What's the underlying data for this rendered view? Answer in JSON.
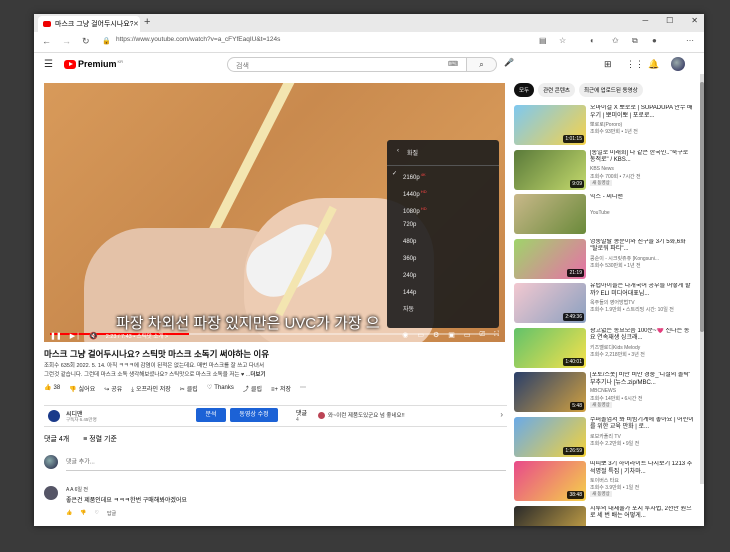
{
  "browser": {
    "tab_title": "마스크 그냥 걸어두시나요? 스틱",
    "tab_close": "✕",
    "new_tab": "+",
    "url": "https://www.youtube.com/watch?v=a_cFYfEaqIU&t=124s"
  },
  "header": {
    "logo": "Premium",
    "logo_region": "KR",
    "search_placeholder": "검색"
  },
  "player": {
    "subtitle": "파장 차외선 파장 있지만은 UVC가 가장 으",
    "time": "2:23 / 7:43 • 스틱맛 소개 >",
    "progress": 0.31,
    "quality_menu": {
      "header": "화질",
      "options": [
        "2160p",
        "1440p",
        "1080p",
        "720p",
        "480p",
        "360p",
        "240p",
        "144p",
        "자동"
      ],
      "hd_badges": [
        "4K",
        "HD",
        "HD",
        "",
        "",
        "",
        "",
        "",
        ""
      ],
      "selected": "2160p"
    }
  },
  "video": {
    "title": "마스크 그냥 걸어두시나요? 스틱맛 마스크 소독기 써야하는 이유",
    "meta_line1": "조회수 635회 2022. 5. 14. 아직 ㅋㅋㅋ에 감염이 된적은 없는데요. 매번 마스크를 잘 쓰고 다녀서",
    "meta_line2": "그런것 같습니다. 그런데 마스크 소독 생각해보셨나요? 스틱맛으로 마스크 소독을 저는 ♥ ...",
    "more": "더보기",
    "actions": [
      {
        "icon": "👍",
        "label": "38"
      },
      {
        "icon": "👎",
        "label": "싫어요"
      },
      {
        "icon": "↪",
        "label": "공유"
      },
      {
        "icon": "⤓",
        "label": "오프라인 저장"
      },
      {
        "icon": "✂",
        "label": "클립"
      },
      {
        "icon": "♡",
        "label": "Thanks"
      },
      {
        "icon": "⤴",
        "label": "클립"
      },
      {
        "icon": "≡+",
        "label": "저장"
      },
      {
        "icon": "⋯",
        "label": ""
      }
    ]
  },
  "channel": {
    "name": "씨디맨",
    "subs": "구독자 6.45만명",
    "analytics_btn": "분석",
    "edit_btn": "동영상 수정",
    "comments_label": "댓글",
    "comments_num": "4",
    "comment_preview": "와~이런 제품도있군요 넘 좋네요!!"
  },
  "comments": {
    "count_label": "댓글 4개",
    "sort_label": "정렬 기준",
    "add_placeholder": "댓글 추가...",
    "first": {
      "user": "A A",
      "time": "6일 전",
      "text": "좋은건 제품인데요 ㅋㅋㅋ한번 구매해봐야겠어요",
      "reply": "답글"
    }
  },
  "sidebar": {
    "chips": [
      "모두",
      "관련 콘텐츠",
      "최근에 업로드된 동영상"
    ],
    "items": [
      {
        "title": "오마이걸 X 뽀로로 | SUPADUPA 안무 배우기 | 뽀미이뽀 | 포로로...",
        "channel": "뽀로로(Pororo)",
        "views": "조회수 93만회 • 1년 전",
        "badge": "",
        "dur": "1:01:15",
        "c1": "#7ec8f0",
        "c2": "#f6d24a"
      },
      {
        "title": "[통일로 미래회] 다 같은 한국인..\"죽구로 동적로\" / KBS...",
        "channel": "KBS News",
        "views": "조회수 700회 • 7시간 전",
        "badge": "새 동영상",
        "dur": "9:09",
        "c1": "#5a7a3a",
        "c2": "#c3d96c"
      },
      {
        "title": "믹스 - 씨디맨",
        "channel": "YouTube",
        "views": "",
        "badge": "",
        "dur": "",
        "c1": "#c9b88a",
        "c2": "#6a8a3a"
      },
      {
        "title": "엉뚱발랄 콩순이와 친구들 3기 5화,6화 \"탈로워 파티\"...",
        "channel": "콩순이 - 시크릿쥬쥬 [Kongsuni...",
        "views": "조회수 530만회 • 1년 전",
        "badge": "",
        "dur": "21:19",
        "c1": "#9fd46a",
        "c2": "#e86fa8"
      },
      {
        "title": "유럽아이들은 다개국어 공부를 어떻게 할까? ELI 미디어대표님...",
        "channel": "옥주들의 영어방법TV",
        "views": "조회수 1.9만회 • 스트리밍 시간: 10일 전",
        "badge": "",
        "dur": "2:49:36",
        "c1": "#f2c8d0",
        "c2": "#8aa0c0"
      },
      {
        "title": "광고없는 동요모음 100분~💗 신나는 동요 연속재생 싱크래...",
        "channel": "키즈멜로디Kids Melody",
        "views": "조회수 2,218만회 • 3년 전",
        "badge": "",
        "dur": "1:40:01",
        "c1": "#62c26a",
        "c2": "#f7e24c"
      },
      {
        "title": "[포토/스폿] 비만 비만 경충_'디절의 몰락' 부추기나 [뉴스.zip/MBC...",
        "channel": "MBCNEWS",
        "views": "조회수 14만회 • 6시간 전",
        "badge": "새 동영상",
        "dur": "5:48",
        "c1": "#2a3f6a",
        "c2": "#d0a040"
      },
      {
        "title": "수퍼돌업서 봐 비빔기계에 놓아요 | 어린이를 위한 교육 만화 | 로...",
        "channel": "로보카폴리 TV",
        "views": "조회수 2.2만회 • 9일 전",
        "badge": "",
        "dur": "1:26:59",
        "c1": "#6aaae8",
        "c2": "#f4d23a"
      },
      {
        "title": "띠띠뽀 3기 하이라이트 다시보기 1213 추석명절 특집 | 기차마...",
        "channel": "토이버스 타요",
        "views": "조회수 3.9만회 • 1일 전",
        "badge": "새 동영상",
        "dur": "38:48",
        "c1": "#e84a8a",
        "c2": "#f5d14a"
      },
      {
        "title": "시루의 대체불가 포지 투자법, 2천만 원으로 세 번 배는 어떻게...",
        "channel": "",
        "views": "",
        "badge": "",
        "dur": "",
        "c1": "#2a2a2a",
        "c2": "#d8b04a"
      }
    ]
  }
}
